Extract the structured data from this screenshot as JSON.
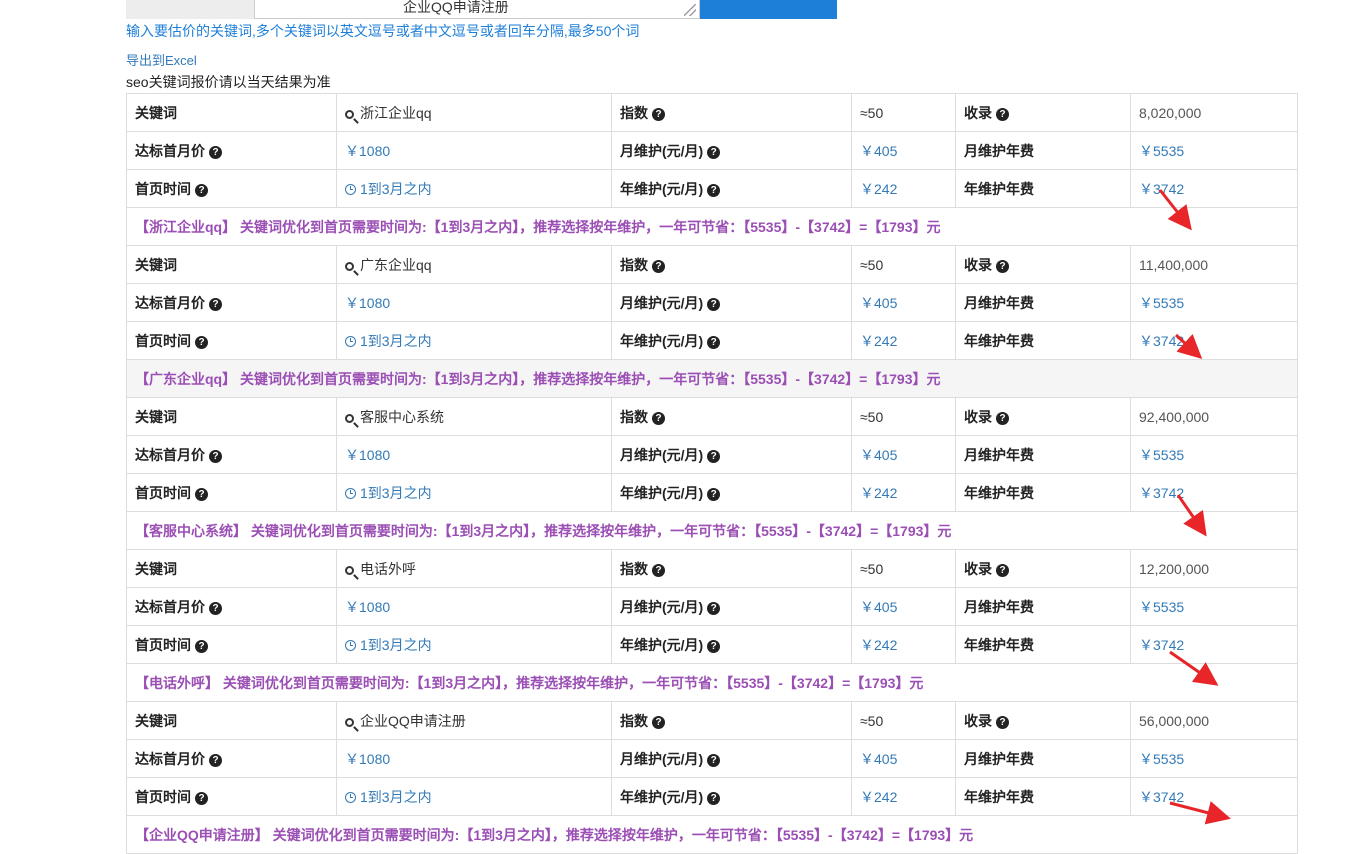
{
  "search": {
    "input_value": "企业QQ申请注册",
    "hint": "输入要估价的关键词,多个关键词以英文逗号或者中文逗号或者回车分隔,最多50个词",
    "export_label": "导出到Excel",
    "note": "seo关键词报价请以当天结果为准"
  },
  "labels": {
    "keyword": "关键词",
    "index": "指数",
    "indexed": "收录",
    "first_month_price": "达标首月价",
    "monthly_maint": "月维护(元/月)",
    "monthly_maint_annual": "月维护年费",
    "first_page_time": "首页时间",
    "annual_maint": "年维护(元/月)",
    "annual_maint_fee": "年维护年费"
  },
  "colors": {
    "link_blue": "#337ab7",
    "summary_purple": "#9b4fb4",
    "submit_blue": "#1e7fd8",
    "arrow_red": "#e8262a"
  },
  "icons": [
    "question-circle-icon",
    "search-icon",
    "clock-icon",
    "red-arrow-annotation"
  ],
  "results": [
    {
      "keyword": "浙江企业qq",
      "index": "≈50",
      "indexed": "8,020,000",
      "first_month_price": "￥1080",
      "monthly_maint": "￥405",
      "monthly_maint_annual": "￥5535",
      "first_page_time": "1到3月之内",
      "annual_maint": "￥242",
      "annual_maint_fee": "￥3742",
      "summary": "【浙江企业qq】 关键词优化到首页需要时间为:【1到3月之内】，推荐选择按年维护，一年可节省：【5535】-【3742】=【1793】元"
    },
    {
      "keyword": "广东企业qq",
      "index": "≈50",
      "indexed": "11,400,000",
      "first_month_price": "￥1080",
      "monthly_maint": "￥405",
      "monthly_maint_annual": "￥5535",
      "first_page_time": "1到3月之内",
      "annual_maint": "￥242",
      "annual_maint_fee": "￥3742",
      "summary": "【广东企业qq】 关键词优化到首页需要时间为:【1到3月之内】，推荐选择按年维护，一年可节省：【5535】-【3742】=【1793】元"
    },
    {
      "keyword": "客服中心系统",
      "index": "≈50",
      "indexed": "92,400,000",
      "first_month_price": "￥1080",
      "monthly_maint": "￥405",
      "monthly_maint_annual": "￥5535",
      "first_page_time": "1到3月之内",
      "annual_maint": "￥242",
      "annual_maint_fee": "￥3742",
      "summary": "【客服中心系统】 关键词优化到首页需要时间为:【1到3月之内】，推荐选择按年维护，一年可节省：【5535】-【3742】=【1793】元"
    },
    {
      "keyword": "电话外呼",
      "index": "≈50",
      "indexed": "12,200,000",
      "first_month_price": "￥1080",
      "monthly_maint": "￥405",
      "monthly_maint_annual": "￥5535",
      "first_page_time": "1到3月之内",
      "annual_maint": "￥242",
      "annual_maint_fee": "￥3742",
      "summary": "【电话外呼】 关键词优化到首页需要时间为:【1到3月之内】，推荐选择按年维护，一年可节省：【5535】-【3742】=【1793】元"
    },
    {
      "keyword": "企业QQ申请注册",
      "index": "≈50",
      "indexed": "56,000,000",
      "first_month_price": "￥1080",
      "monthly_maint": "￥405",
      "monthly_maint_annual": "￥5535",
      "first_page_time": "1到3月之内",
      "annual_maint": "￥242",
      "annual_maint_fee": "￥3742",
      "summary": "【企业QQ申请注册】 关键词优化到首页需要时间为:【1到3月之内】，推荐选择按年维护，一年可节省：【5535】-【3742】=【1793】元"
    }
  ]
}
